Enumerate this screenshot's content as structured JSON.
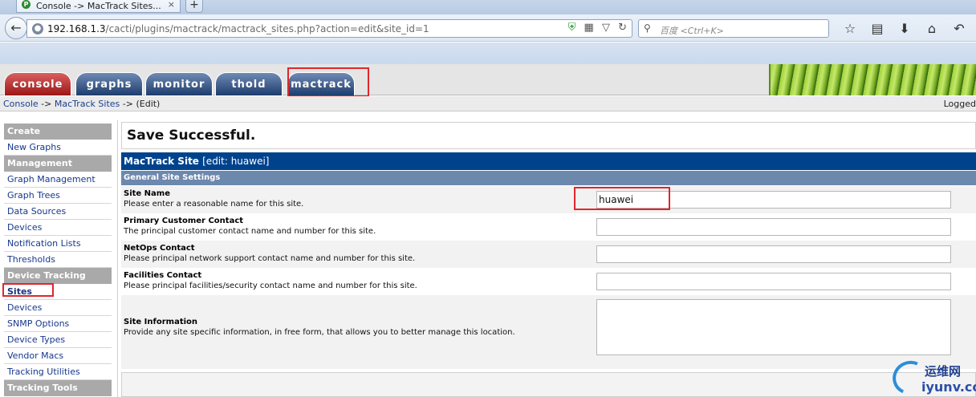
{
  "browser": {
    "tab_title": "Console -> MacTrack Sites...",
    "tab_close": "×",
    "new_tab": "+",
    "url_host": "192.168.1.3",
    "url_path": "/cacti/plugins/mactrack/mactrack_sites.php?action=edit&site_id=1",
    "search_placeholder": "百度 <Ctrl+K>"
  },
  "cacti_tabs": [
    "console",
    "graphs",
    "monitor",
    "thold",
    "mactrack"
  ],
  "breadcrumb": {
    "console": "Console",
    "sep1": " -> ",
    "mactrack_sites": "MacTrack Sites",
    "sep2": " -> ",
    "current": "(Edit)",
    "logged": "Logged"
  },
  "menu": [
    {
      "type": "header",
      "label": "Create"
    },
    {
      "type": "item",
      "label": "New Graphs"
    },
    {
      "type": "header",
      "label": "Management"
    },
    {
      "type": "item",
      "label": "Graph Management"
    },
    {
      "type": "item",
      "label": "Graph Trees"
    },
    {
      "type": "item",
      "label": "Data Sources"
    },
    {
      "type": "item",
      "label": "Devices"
    },
    {
      "type": "item",
      "label": "Notification Lists"
    },
    {
      "type": "item",
      "label": "Thresholds"
    },
    {
      "type": "header",
      "label": "Device Tracking"
    },
    {
      "type": "item",
      "label": "Sites",
      "active": true
    },
    {
      "type": "item",
      "label": "Devices"
    },
    {
      "type": "item",
      "label": "SNMP Options"
    },
    {
      "type": "item",
      "label": "Device Types"
    },
    {
      "type": "item",
      "label": "Vendor Macs"
    },
    {
      "type": "item",
      "label": "Tracking Utilities"
    },
    {
      "type": "header",
      "label": "Tracking Tools"
    }
  ],
  "main": {
    "save_message": "Save Successful.",
    "site_title": "MacTrack Site",
    "site_edit": "[edit: huawei]",
    "section": "General Site Settings",
    "fields": [
      {
        "label": "Site Name",
        "desc": "Please enter a reasonable name for this site.",
        "value": "huawei"
      },
      {
        "label": "Primary Customer Contact",
        "desc": "The principal customer contact name and number for this site.",
        "value": ""
      },
      {
        "label": "NetOps Contact",
        "desc": "Please principal network support contact name and number for this site.",
        "value": ""
      },
      {
        "label": "Facilities Contact",
        "desc": "Please principal facilities/security contact name and number for this site.",
        "value": ""
      }
    ],
    "site_info": {
      "label": "Site Information",
      "desc": "Provide any site specific information, in free form, that allows you to better manage this location.",
      "value": ""
    }
  },
  "watermark": {
    "cn": "运维网",
    "en": "iyunv.com"
  },
  "colors": {
    "highlight": "#e0262b",
    "title_bar": "#00438c",
    "section_bar": "#6d88ad",
    "console_tab": "#b22222",
    "plugin_tab": "#2b4a7a"
  }
}
